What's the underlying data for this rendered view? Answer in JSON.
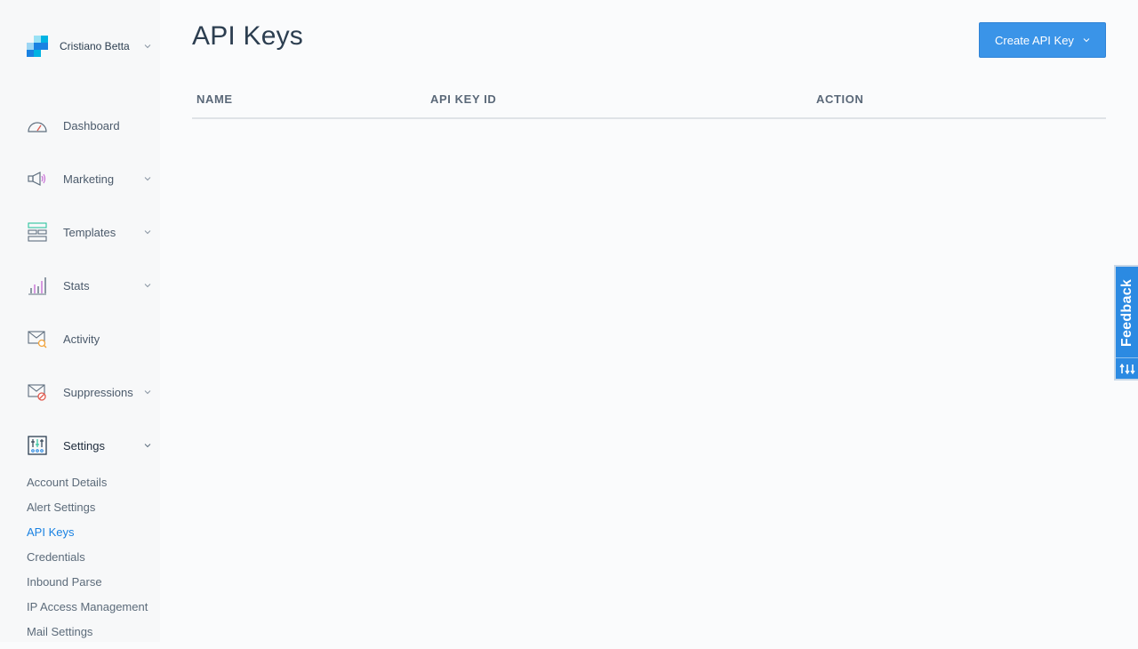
{
  "account": {
    "name": "Cristiano Betta"
  },
  "nav": {
    "items": [
      {
        "label": "Dashboard",
        "icon": "dashboard-gauge-icon"
      },
      {
        "label": "Marketing",
        "icon": "megaphone-icon"
      },
      {
        "label": "Templates",
        "icon": "templates-icon"
      },
      {
        "label": "Stats",
        "icon": "stats-bar-chart-icon"
      },
      {
        "label": "Activity",
        "icon": "activity-mail-icon"
      },
      {
        "label": "Suppressions",
        "icon": "suppressions-mail-icon"
      },
      {
        "label": "Settings",
        "icon": "settings-sliders-icon"
      }
    ],
    "settings_subitems": [
      "Account Details",
      "Alert Settings",
      "API Keys",
      "Credentials",
      "Inbound Parse",
      "IP Access Management",
      "Mail Settings"
    ]
  },
  "page": {
    "title": "API Keys"
  },
  "actions": {
    "create_label": "Create API Key"
  },
  "table": {
    "columns": [
      "NAME",
      "API KEY ID",
      "ACTION"
    ],
    "rows": []
  },
  "feedback": {
    "label": "Feedback"
  },
  "colors": {
    "accent": "#1a82e2",
    "button": "#3a94e8",
    "feedback": "#2b8ae2"
  }
}
